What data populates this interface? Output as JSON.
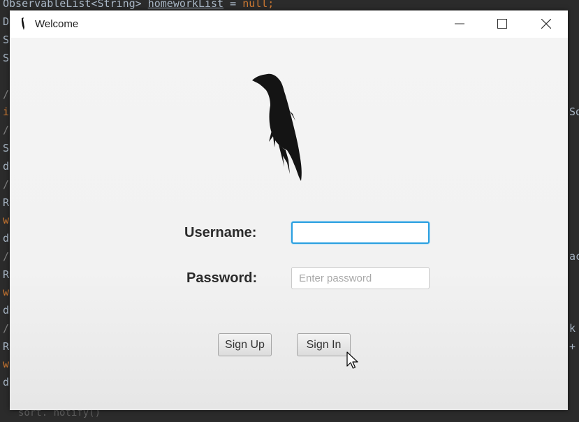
{
  "ide": {
    "top_line_prefix": "ObservableList<String> ",
    "top_line_var": "homeworkList",
    "top_line_eq": " = ",
    "top_line_null": "null;",
    "gutter": [
      "D",
      "S",
      "S",
      "",
      "/",
      "i",
      "/",
      "S",
      "d",
      "/",
      "R",
      "w",
      "d",
      "/",
      "R",
      "w",
      "d",
      "/",
      "R",
      "w",
      "d"
    ],
    "right_margin": [
      "So",
      "",
      "",
      "",
      "",
      "ac",
      "",
      "",
      "k",
      "+"
    ],
    "status_text": "sort. notify()"
  },
  "window": {
    "title": "Welcome",
    "title_icon": "raven-icon",
    "controls": {
      "minimize_icon": "minimize-icon",
      "maximize_icon": "maximize-icon",
      "close_icon": "close-icon"
    }
  },
  "form": {
    "logo_icon": "raven-logo",
    "username_label": "Username:",
    "username_value": "",
    "password_label": "Password:",
    "password_placeholder": "Enter password",
    "signup_label": "Sign Up",
    "signin_label": "Sign In"
  },
  "colors": {
    "focus_border": "#2a9fe0",
    "ide_background": "#2b2b2b",
    "keyword_orange": "#cc7832"
  }
}
